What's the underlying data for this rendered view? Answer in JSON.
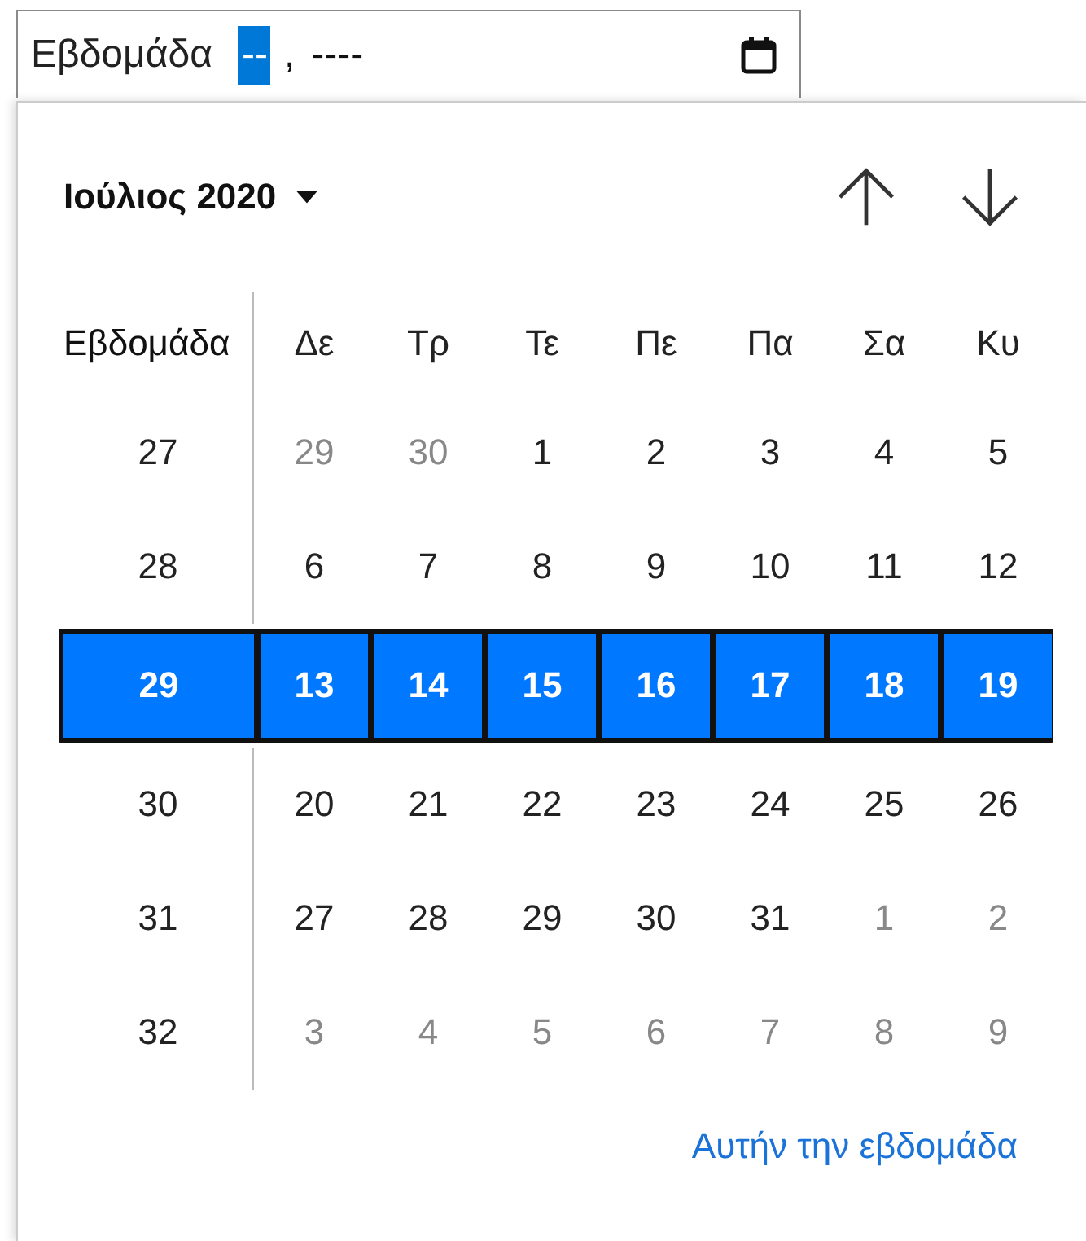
{
  "field": {
    "label": "Εβδομάδα",
    "segments": [
      {
        "text": "--",
        "selected": true
      },
      {
        "text": ",",
        "selected": false
      },
      {
        "text": "----",
        "selected": false
      }
    ]
  },
  "picker": {
    "month": "Ιούλιος 2020",
    "header": {
      "week": "Εβδομάδα",
      "days": [
        "Δε",
        "Τρ",
        "Τε",
        "Πε",
        "Πα",
        "Σα",
        "Κυ"
      ]
    },
    "weeks": [
      {
        "week": "27",
        "selected": false,
        "days": [
          {
            "label": "29",
            "outside": true
          },
          {
            "label": "30",
            "outside": true
          },
          {
            "label": "1",
            "outside": false
          },
          {
            "label": "2",
            "outside": false
          },
          {
            "label": "3",
            "outside": false
          },
          {
            "label": "4",
            "outside": false
          },
          {
            "label": "5",
            "outside": false
          }
        ]
      },
      {
        "week": "28",
        "selected": false,
        "days": [
          {
            "label": "6",
            "outside": false
          },
          {
            "label": "7",
            "outside": false
          },
          {
            "label": "8",
            "outside": false
          },
          {
            "label": "9",
            "outside": false
          },
          {
            "label": "10",
            "outside": false
          },
          {
            "label": "11",
            "outside": false
          },
          {
            "label": "12",
            "outside": false
          }
        ]
      },
      {
        "week": "29",
        "selected": true,
        "days": [
          {
            "label": "13",
            "outside": false
          },
          {
            "label": "14",
            "outside": false
          },
          {
            "label": "15",
            "outside": false
          },
          {
            "label": "16",
            "outside": false
          },
          {
            "label": "17",
            "outside": false
          },
          {
            "label": "18",
            "outside": false
          },
          {
            "label": "19",
            "outside": false
          }
        ]
      },
      {
        "week": "30",
        "selected": false,
        "days": [
          {
            "label": "20",
            "outside": false
          },
          {
            "label": "21",
            "outside": false
          },
          {
            "label": "22",
            "outside": false
          },
          {
            "label": "23",
            "outside": false
          },
          {
            "label": "24",
            "outside": false
          },
          {
            "label": "25",
            "outside": false
          },
          {
            "label": "26",
            "outside": false
          }
        ]
      },
      {
        "week": "31",
        "selected": false,
        "days": [
          {
            "label": "27",
            "outside": false
          },
          {
            "label": "28",
            "outside": false
          },
          {
            "label": "29",
            "outside": false
          },
          {
            "label": "30",
            "outside": false
          },
          {
            "label": "31",
            "outside": false
          },
          {
            "label": "1",
            "outside": true
          },
          {
            "label": "2",
            "outside": true
          }
        ]
      },
      {
        "week": "32",
        "selected": false,
        "days": [
          {
            "label": "3",
            "outside": true
          },
          {
            "label": "4",
            "outside": true
          },
          {
            "label": "5",
            "outside": true
          },
          {
            "label": "6",
            "outside": true
          },
          {
            "label": "7",
            "outside": true
          },
          {
            "label": "8",
            "outside": true
          },
          {
            "label": "9",
            "outside": true
          }
        ]
      }
    ],
    "today_link": "Αυτήν την εβδομάδα"
  }
}
